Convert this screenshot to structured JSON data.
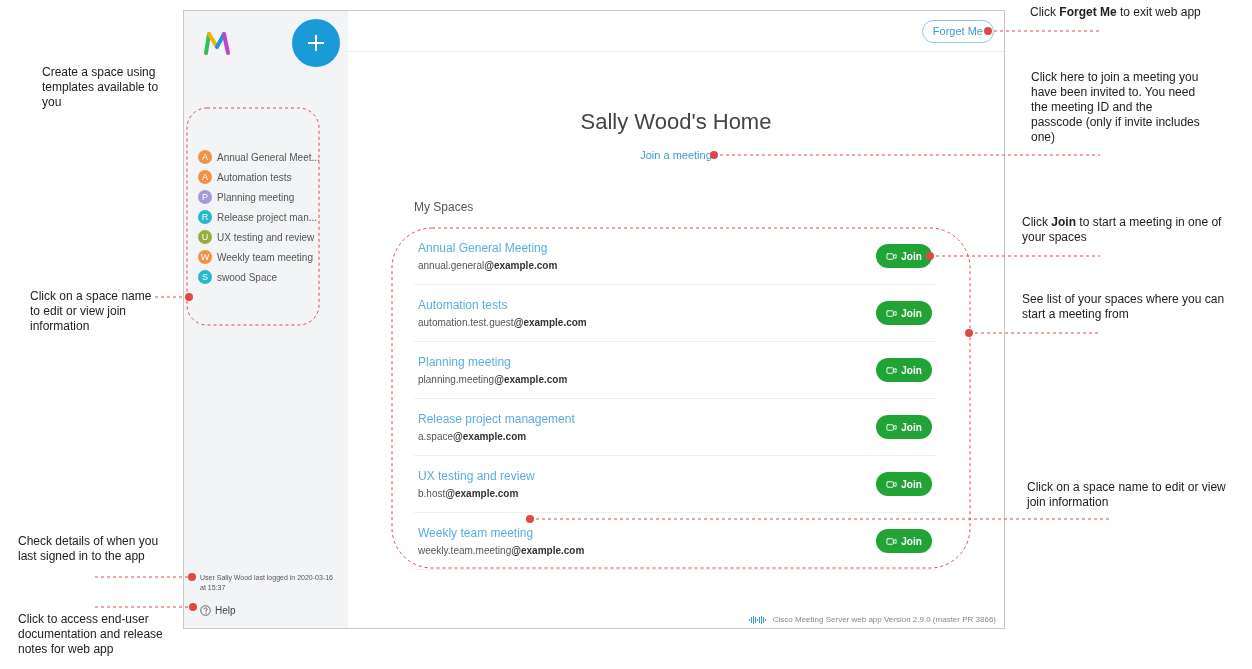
{
  "left_notes": [
    "Create a space using templates available to you",
    "Click on a space name to edit or view join information",
    "Check details of when you last signed in to the app",
    "Click to access end-user documentation and release notes for web app"
  ],
  "sidebar": {
    "items": [
      {
        "letter": "A",
        "label": "Annual General Meet...",
        "color": "#f0934a"
      },
      {
        "letter": "A",
        "label": "Automation tests",
        "color": "#f0934a"
      },
      {
        "letter": "P",
        "label": "Planning meeting",
        "color": "#a59ad6"
      },
      {
        "letter": "R",
        "label": "Release project man...",
        "color": "#27b8c9"
      },
      {
        "letter": "U",
        "label": "UX testing and review",
        "color": "#97ad3c"
      },
      {
        "letter": "W",
        "label": "Weekly team meeting",
        "color": "#f0934a"
      },
      {
        "letter": "S",
        "label": "swood Space",
        "color": "#27b8c9"
      }
    ],
    "last_login": "User Sally Wood last logged in 2020-03-16 at 15:37",
    "help": "Help"
  },
  "header": {
    "forget_button": "Forget Me"
  },
  "home": {
    "title": "Sally Wood's Home",
    "join_link": "Join a meeting",
    "section_title": "My Spaces"
  },
  "spaces": [
    {
      "name": "Annual General Meeting",
      "address": "annual.general**@example.com**",
      "button": "Join"
    },
    {
      "name": "Automation tests",
      "address": "automation.test.guest**@example.com**",
      "button": "Join"
    },
    {
      "name": "Planning meeting",
      "address": "planning.meeting**@example.com**",
      "button": "Join"
    },
    {
      "name": "Release project management",
      "address": "a.space**@example.com**",
      "button": "Join"
    },
    {
      "name": "UX testing and review",
      "address": "b.host**@example.com**",
      "button": "Join"
    },
    {
      "name": "Weekly team meeting",
      "address": "weekly.team.meeting**@example.com**",
      "button": "Join"
    }
  ],
  "footer": "Cisco Meeting Server web app Version 2.9.0 (master PR 3866)",
  "right_notes": [
    "Click **Forget Me** to exit web app",
    "Click here to join a meeting you have been invited to. You need the meeting ID and the passcode (only if invite includes one)",
    "Click **Join** to start a meeting in one of your spaces",
    "See list of your spaces where you can start a meeting from",
    "Click on a space name to edit or view join information"
  ]
}
